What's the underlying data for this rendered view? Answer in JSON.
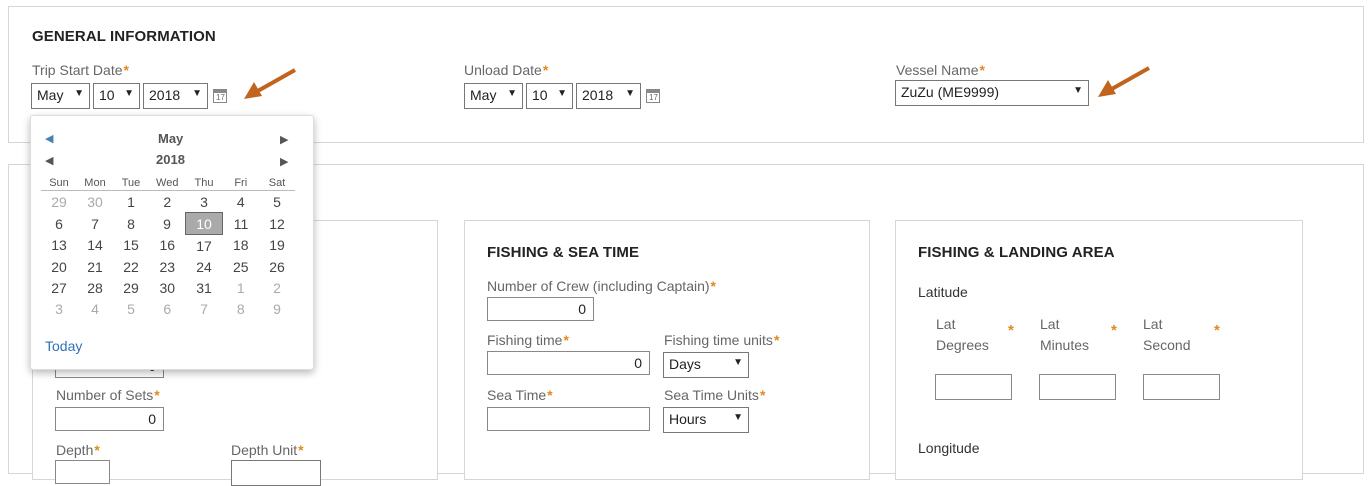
{
  "general": {
    "heading": "GENERAL INFORMATION",
    "trip_start": {
      "label": "Trip Start Date",
      "month": "May",
      "day": "10",
      "year": "2018"
    },
    "unload": {
      "label": "Unload Date",
      "month": "May",
      "day": "10",
      "year": "2018"
    },
    "vessel": {
      "label": "Vessel Name",
      "value": "ZuZu (ME9999)"
    }
  },
  "datepicker": {
    "month": "May",
    "year": "2018",
    "weekdays": [
      "Sun",
      "Mon",
      "Tue",
      "Wed",
      "Thu",
      "Fri",
      "Sat"
    ],
    "weeks": [
      [
        "29",
        "30",
        "1",
        "2",
        "3",
        "4",
        "5"
      ],
      [
        "6",
        "7",
        "8",
        "9",
        "10",
        "11",
        "12"
      ],
      [
        "13",
        "14",
        "15",
        "16",
        "17",
        "18",
        "19"
      ],
      [
        "20",
        "21",
        "22",
        "23",
        "24",
        "25",
        "26"
      ],
      [
        "27",
        "28",
        "29",
        "30",
        "31",
        "1",
        "2"
      ],
      [
        "3",
        "4",
        "5",
        "6",
        "7",
        "8",
        "9"
      ]
    ],
    "selected_day": "10",
    "today_label": "Today"
  },
  "gear": {
    "sets_label": "Number of Sets",
    "sets_value": "0",
    "depth_label": "Depth",
    "depth_unit_label": "Depth Unit",
    "hidden_value": "0"
  },
  "fishing_sea_time": {
    "heading": "FISHING & SEA TIME",
    "crew_label": "Number of Crew (including Captain)",
    "crew_value": "0",
    "fishing_time_label": "Fishing time",
    "fishing_time_value": "0",
    "fishing_units_label": "Fishing time units",
    "fishing_units_value": "Days",
    "sea_time_label": "Sea Time",
    "sea_time_value": "",
    "sea_units_label": "Sea Time Units",
    "sea_units_value": "Hours"
  },
  "landing_area": {
    "heading": "FISHING & LANDING AREA",
    "latitude_label": "Latitude",
    "lat_degrees_1": "Lat",
    "lat_degrees_2": "Degrees",
    "lat_minutes_1": "Lat",
    "lat_minutes_2": "Minutes",
    "lat_second_1": "Lat",
    "lat_second_2": "Second",
    "longitude_label": "Longitude"
  },
  "colors": {
    "required_star": "#e08a1e",
    "arrow": "#c0641e",
    "link": "#2e73b8"
  }
}
